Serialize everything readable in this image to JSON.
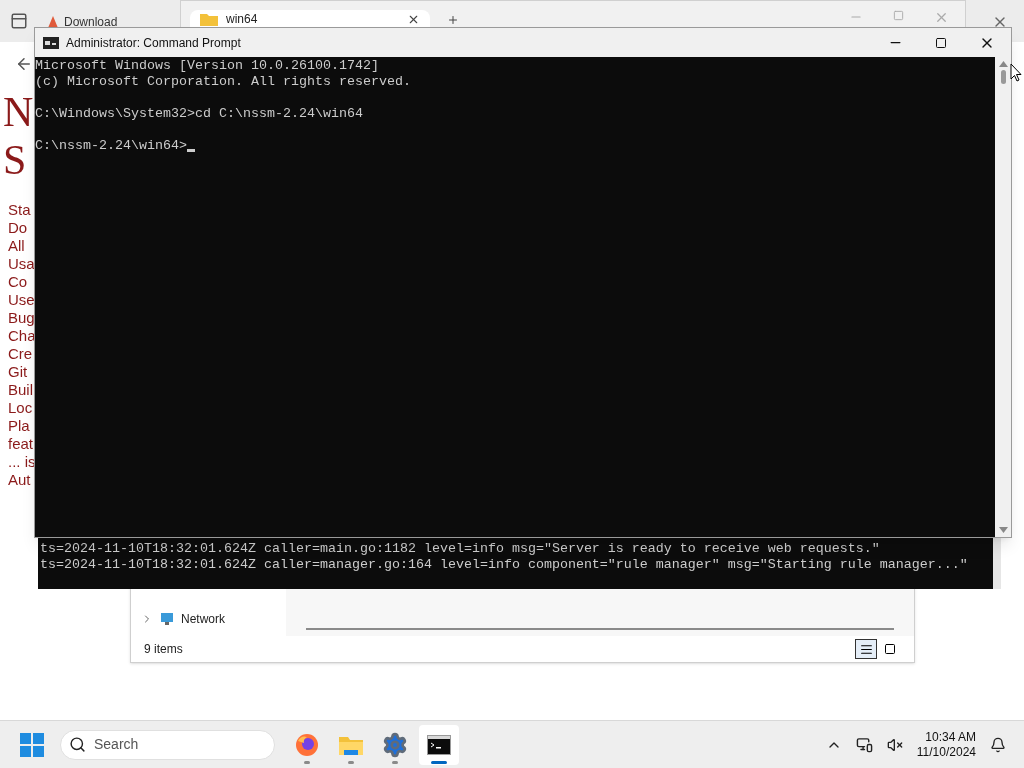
{
  "browser": {
    "tab_title": "Download",
    "logo_letters": [
      "N",
      "S"
    ],
    "links": [
      "Sta",
      "Do",
      "All",
      "Usa",
      "Co",
      "Use",
      "Bug",
      "Cha",
      "Cre",
      "Git",
      "Buil",
      "Loc",
      "Pla",
      "feat",
      "... is",
      "Aut"
    ]
  },
  "explorer_top": {
    "tabs": [
      {
        "label": "win64",
        "selected": true
      }
    ]
  },
  "cmd": {
    "title": "Administrator: Command Prompt",
    "cursor": true,
    "blocks": [
      [
        "Microsoft Windows [Version 10.0.26100.1742]",
        "(c) Microsoft Corporation. All rights reserved."
      ],
      [
        "C:\\Windows\\System32>cd C:\\nssm-2.24\\win64"
      ],
      [
        "C:\\nssm-2.24\\win64>"
      ]
    ]
  },
  "log_window": {
    "lines": [
      "ts=2024-11-10T18:32:01.624Z caller=main.go:1182 level=info msg=\"Server is ready to receive web requests.\"",
      "ts=2024-11-10T18:32:01.624Z caller=manager.go:164 level=info component=\"rule manager\" msg=\"Starting rule manager...\""
    ]
  },
  "explorer": {
    "nav_items": [
      {
        "label": "Network",
        "expanded": false
      }
    ],
    "status": "9 items",
    "views": [
      {
        "kind": "details",
        "selected": true
      },
      {
        "kind": "tiles",
        "selected": false
      }
    ]
  },
  "taskbar": {
    "search_placeholder": "Search",
    "apps": [
      {
        "kind": "firefox",
        "selected": false
      },
      {
        "kind": "folder",
        "selected": false
      },
      {
        "kind": "settings",
        "selected": false
      },
      {
        "kind": "terminal",
        "selected": true
      }
    ],
    "time": "10:34 AM",
    "date": "11/10/2024"
  }
}
